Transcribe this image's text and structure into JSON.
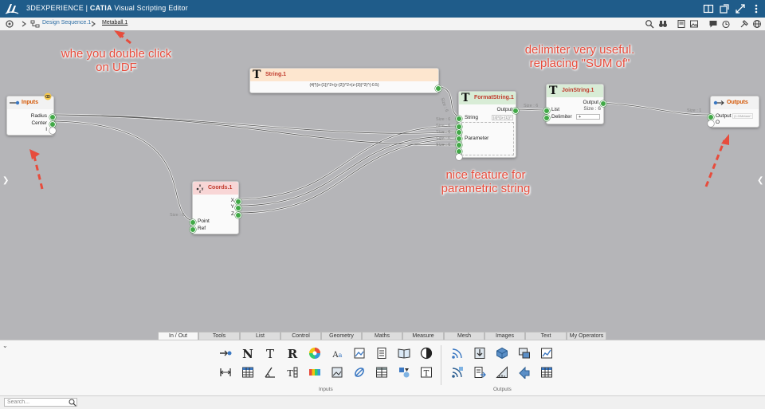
{
  "window": {
    "brand": "3DEXPERIENCE",
    "product": "CATIA",
    "title": "Visual Scripting Editor"
  },
  "breadcrumb": {
    "items": [
      "Design Sequence.1",
      "Metaball.1"
    ]
  },
  "annotations": {
    "udf": "whe you double click\non UDF",
    "delimiter": "delimiter very useful.\nreplacing \"SUM of\"",
    "format": "nice feature for\nparametric string"
  },
  "nodes": {
    "inputs": {
      "title": "Inputs",
      "ports": [
        "Radius",
        "Center",
        "I"
      ]
    },
    "string1": {
      "title": "String.1",
      "value": "(4|*|(x-{1})^2+(y-{2})^2+(z-{3})^2)^(-0.5)"
    },
    "format": {
      "title": "FormatString.1",
      "output": "Output",
      "string": "String",
      "string_value": "{4}*((x-{1})^",
      "parameter": "Parameter"
    },
    "join": {
      "title": "JoinString.1",
      "output": "Output",
      "size": "Size : 6",
      "list": "List",
      "delimiter": "Delimiter",
      "delimiter_value": "+"
    },
    "outputs": {
      "title": "Outputs",
      "output": "Output",
      "output_value": "(1.0/Metam*",
      "o": "O"
    },
    "coords": {
      "title": "Coords.1",
      "ports": [
        "X",
        "Y",
        "Z",
        "Point",
        "Ref"
      ]
    }
  },
  "size_labels": [
    "Size : 6",
    "Size : 6",
    "Size : 6",
    "Size : 6",
    "Size : 6",
    "Size : 6",
    "Size : 6",
    "Size : 6",
    "Size : 1"
  ],
  "tabs": [
    "In / Out",
    "Tools",
    "List",
    "Control",
    "Geometry",
    "Maths",
    "Measure",
    "Mesh",
    "Images",
    "Text",
    "My Operators"
  ],
  "active_tab": "In / Out",
  "palette": {
    "groups": [
      "Inputs",
      "Outputs"
    ]
  },
  "search": {
    "placeholder": "Search..."
  },
  "colors": {
    "titlebar": "#1f5c8a",
    "canvas": "#b5b5b8",
    "port": "#41a947",
    "annotation": "#e74c3c",
    "node_text_header": "#fde6cf",
    "node_join_header": "#d8ecd6",
    "node_coords_header": "#f8d6d6"
  }
}
